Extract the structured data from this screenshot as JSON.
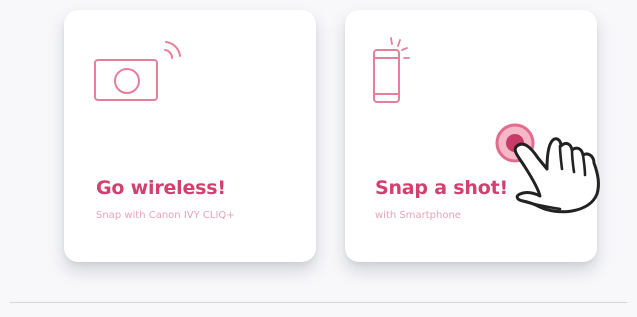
{
  "cards": [
    {
      "title": "Go wireless!",
      "subtitle": "Snap with Canon IVY CLIQ+",
      "icon": "camera-wireless-icon"
    },
    {
      "title": "Snap a shot!",
      "subtitle": "with Smartphone",
      "icon": "smartphone-icon"
    }
  ],
  "colors": {
    "accent": "#d53f6d",
    "accent_light": "#e57f9b",
    "subtitle": "#e5a4b6",
    "background": "#f8f8fb",
    "card": "#ffffff"
  },
  "overlay": {
    "icon": "tapping-hand-icon"
  }
}
